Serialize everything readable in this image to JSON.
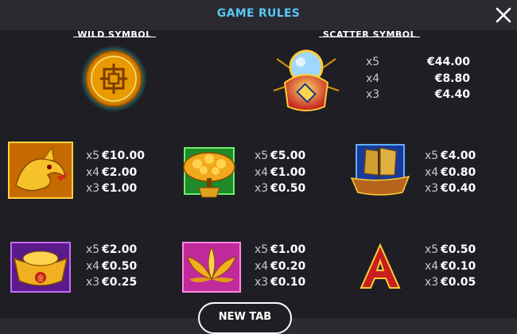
{
  "header": {
    "title": "GAME RULES",
    "close_icon": "close-icon"
  },
  "sections": {
    "wild_label": "WILD SYMBOL",
    "scatter_label": "SCATTER SYMBOL"
  },
  "scatter_pays": [
    {
      "mult": "x5",
      "value": "€44.00"
    },
    {
      "mult": "x4",
      "value": "€8.80"
    },
    {
      "mult": "x3",
      "value": "€4.40"
    }
  ],
  "symbols": [
    {
      "icon": "dragon-icon",
      "pays": [
        {
          "mult": "x5",
          "value": "€10.00"
        },
        {
          "mult": "x4",
          "value": "€2.00"
        },
        {
          "mult": "x3",
          "value": "€1.00"
        }
      ]
    },
    {
      "icon": "money-tree-icon",
      "pays": [
        {
          "mult": "x5",
          "value": "€5.00"
        },
        {
          "mult": "x4",
          "value": "€1.00"
        },
        {
          "mult": "x3",
          "value": "€0.50"
        }
      ]
    },
    {
      "icon": "junk-ship-icon",
      "pays": [
        {
          "mult": "x5",
          "value": "€4.00"
        },
        {
          "mult": "x4",
          "value": "€0.80"
        },
        {
          "mult": "x3",
          "value": "€0.40"
        }
      ]
    },
    {
      "icon": "gold-ingot-icon",
      "pays": [
        {
          "mult": "x5",
          "value": "€2.00"
        },
        {
          "mult": "x4",
          "value": "€0.50"
        },
        {
          "mult": "x3",
          "value": "€0.25"
        }
      ]
    },
    {
      "icon": "lotus-icon",
      "pays": [
        {
          "mult": "x5",
          "value": "€1.00"
        },
        {
          "mult": "x4",
          "value": "€0.20"
        },
        {
          "mult": "x3",
          "value": "€0.10"
        }
      ]
    },
    {
      "icon": "letter-a-icon",
      "pays": [
        {
          "mult": "x5",
          "value": "€0.50"
        },
        {
          "mult": "x4",
          "value": "€0.10"
        },
        {
          "mult": "x3",
          "value": "€0.05"
        }
      ]
    }
  ],
  "footer": {
    "new_tab_label": "NEW TAB"
  },
  "colors": {
    "title": "#58c7f3",
    "background": "#1f1e24",
    "header": "#2b2a31",
    "gold": "#f4b400"
  }
}
